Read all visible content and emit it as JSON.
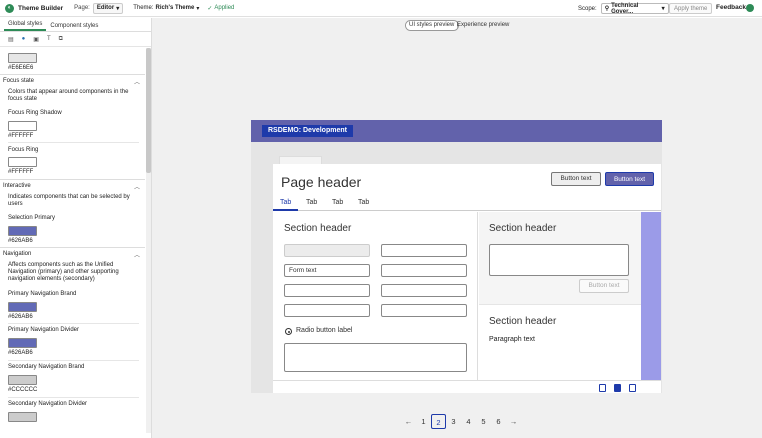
{
  "topbar": {
    "app_title": "Theme Builder",
    "page_label": "Page:",
    "page_value": "Editor",
    "theme_label": "Theme:",
    "theme_value": "Rich's Theme",
    "applied": "Applied",
    "scope_label": "Scope:",
    "scope_value": "Technical Gover...",
    "apply_button": "Apply theme",
    "feedback": "Feedback"
  },
  "left_panel": {
    "tabs": [
      "Global styles",
      "Component styles"
    ],
    "top_hex": "#E6E6E6",
    "focus_state": {
      "title": "Focus state",
      "desc": "Colors that appear around components in the focus state",
      "ring_shadow_label": "Focus Ring Shadow",
      "ring_shadow_hex": "#FFFFFF",
      "ring_label": "Focus Ring",
      "ring_hex": "#FFFFFF"
    },
    "interactive": {
      "title": "Interactive",
      "desc": "Indicates components that can be selected by users",
      "selection_primary_label": "Selection Primary",
      "selection_primary_hex": "#626AB6"
    },
    "navigation": {
      "title": "Navigation",
      "desc": "Affects components such as the Unified Navigation (primary) and other supporting navigation elements (secondary)",
      "primary_brand_label": "Primary Navigation Brand",
      "primary_brand_hex": "#626AB6",
      "primary_divider_label": "Primary Navigation Divider",
      "primary_divider_hex": "#626AB6",
      "secondary_brand_label": "Secondary Navigation Brand",
      "secondary_brand_hex": "#CCCCCC",
      "secondary_divider_label": "Secondary Navigation Divider"
    }
  },
  "preview": {
    "toggle_ui": "UI styles preview",
    "toggle_experience": "Experience preview",
    "banner_title": "RSDEMO: Development",
    "page_header": "Page header",
    "button_outline": "Button text",
    "button_solid": "Button text",
    "tabs": [
      "Tab",
      "Tab",
      "Tab",
      "Tab"
    ],
    "left_section_header": "Section header",
    "form_text": "Form text",
    "radio_label": "Radio button label",
    "right_section_header_1": "Section header",
    "right_button": "Button text",
    "right_section_header_2": "Section header",
    "paragraph": "Paragraph text"
  },
  "pager": {
    "prev": "←",
    "pages": [
      "1",
      "2",
      "3",
      "4",
      "5",
      "6"
    ],
    "next": "→"
  },
  "colors": {
    "brand": "#626AB6",
    "accent_dark": "#1E3AAA",
    "success": "#2E8B57"
  }
}
